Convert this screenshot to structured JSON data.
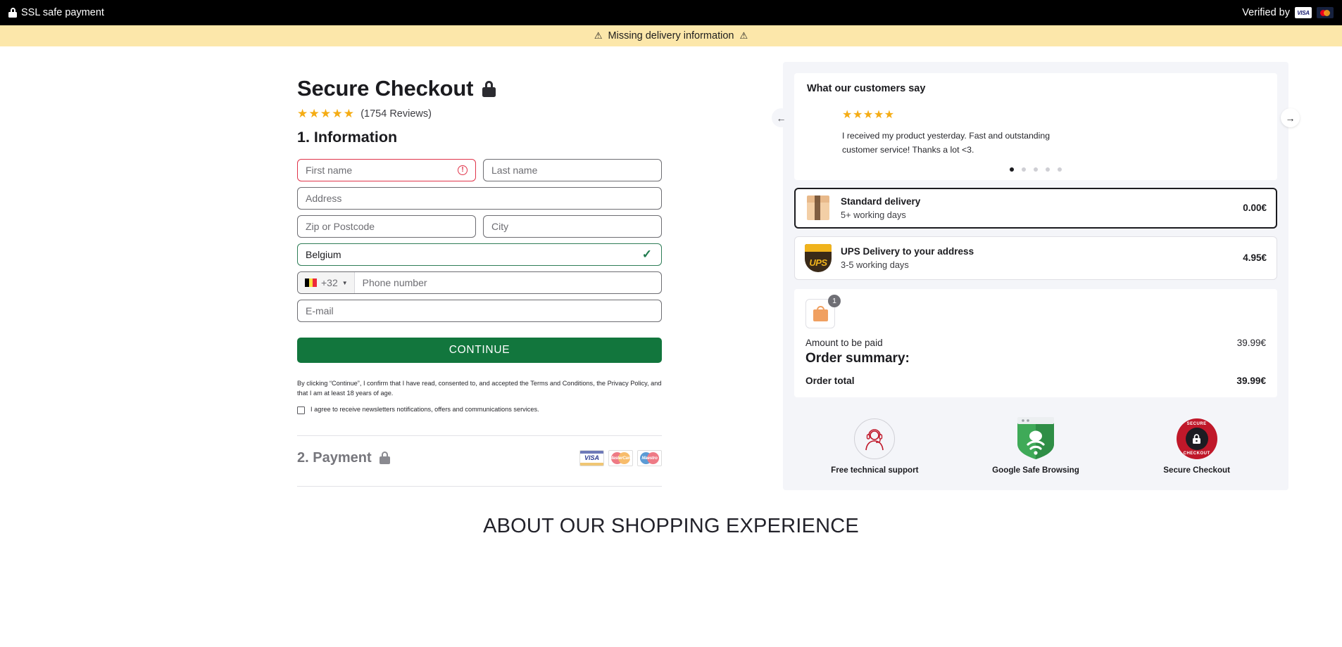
{
  "topbar": {
    "ssl_text": "SSL safe payment",
    "lock_icon": "lock-icon",
    "verified_text": "Verified by",
    "visa_label": "VISA",
    "mastercard_label": "MasterCard"
  },
  "warning": {
    "text": "Missing delivery information",
    "icon_left": "warning-triangle-icon",
    "icon_right": "warning-triangle-icon"
  },
  "header": {
    "title": "Secure Checkout",
    "lock_icon": "lock-icon",
    "stars": "★★★★",
    "half_star": "★",
    "rating_value": 4.5,
    "reviews": "(1754 Reviews)"
  },
  "step1": {
    "heading": "1. Information",
    "fields": {
      "first_name": {
        "placeholder": "First name",
        "value": "",
        "state": "error",
        "error_icon": "exclamation-circle-icon"
      },
      "last_name": {
        "placeholder": "Last name",
        "value": ""
      },
      "address": {
        "placeholder": "Address",
        "value": ""
      },
      "zip": {
        "placeholder": "Zip or Postcode",
        "value": ""
      },
      "city": {
        "placeholder": "City",
        "value": ""
      },
      "country": {
        "value": "Belgium",
        "state": "valid",
        "valid_icon": "checkmark-icon"
      },
      "phone": {
        "country_code": "+32",
        "flag": "belgium-flag-icon",
        "placeholder": "Phone number",
        "value": ""
      },
      "email": {
        "placeholder": "E-mail",
        "value": ""
      }
    },
    "continue_label": "CONTINUE",
    "terms_text": "By clicking “Continue”, I confirm that I have read, consented to, and accepted the Terms and Conditions, the Privacy Policy, and that I am at least 18 years of age.",
    "newsletter_label": "I agree to receive newsletters notifications, offers and communications services.",
    "newsletter_checked": false
  },
  "step2": {
    "heading": "2. Payment",
    "lock_icon": "lock-icon",
    "cards": [
      {
        "name": "visa-card-icon",
        "label": "VISA"
      },
      {
        "name": "mastercard-card-icon",
        "label": "MasterCard"
      },
      {
        "name": "maestro-card-icon",
        "label": "Maestro"
      }
    ]
  },
  "testimonial": {
    "heading": "What our customers say",
    "stars": "★★★★★",
    "quote": "I received my product yesterday. Fast and outstanding customer service! Thanks a lot <3.",
    "prev_icon": "arrow-left-icon",
    "next_icon": "arrow-right-icon",
    "dot_count": 5,
    "active_dot": 0
  },
  "shipping": {
    "options": [
      {
        "icon": "package-box-icon",
        "title": "Standard delivery",
        "subtitle": "5+ working days",
        "price": "0.00€",
        "selected": true
      },
      {
        "icon": "ups-logo-icon",
        "title": "UPS Delivery to your address",
        "subtitle": "3-5 working days",
        "price": "4.95€",
        "selected": false
      }
    ]
  },
  "summary": {
    "bag_icon": "shopping-bag-icon",
    "item_count": "1",
    "amount_label": "Amount to be paid",
    "amount_value": "39.99€",
    "title": "Order summary:",
    "total_label": "Order total",
    "total_value": "39.99€"
  },
  "trust_badges": [
    {
      "icon": "headset-support-icon",
      "label": "Free technical support"
    },
    {
      "icon": "google-safe-browsing-shield-icon",
      "label": "Google Safe Browsing"
    },
    {
      "icon": "secure-checkout-seal-icon",
      "label": "Secure Checkout",
      "seal_top": "SECURE",
      "seal_bottom": "CHECKOUT"
    }
  ],
  "footer": {
    "heading": "ABOUT OUR SHOPPING EXPERIENCE"
  },
  "colors": {
    "accent_green": "#12763d",
    "error_red": "#e0344a",
    "valid_green": "#2e7d57",
    "warning_bg": "#fce7aa",
    "star_gold": "#f5ac14",
    "panel_bg": "#f4f5f9"
  }
}
